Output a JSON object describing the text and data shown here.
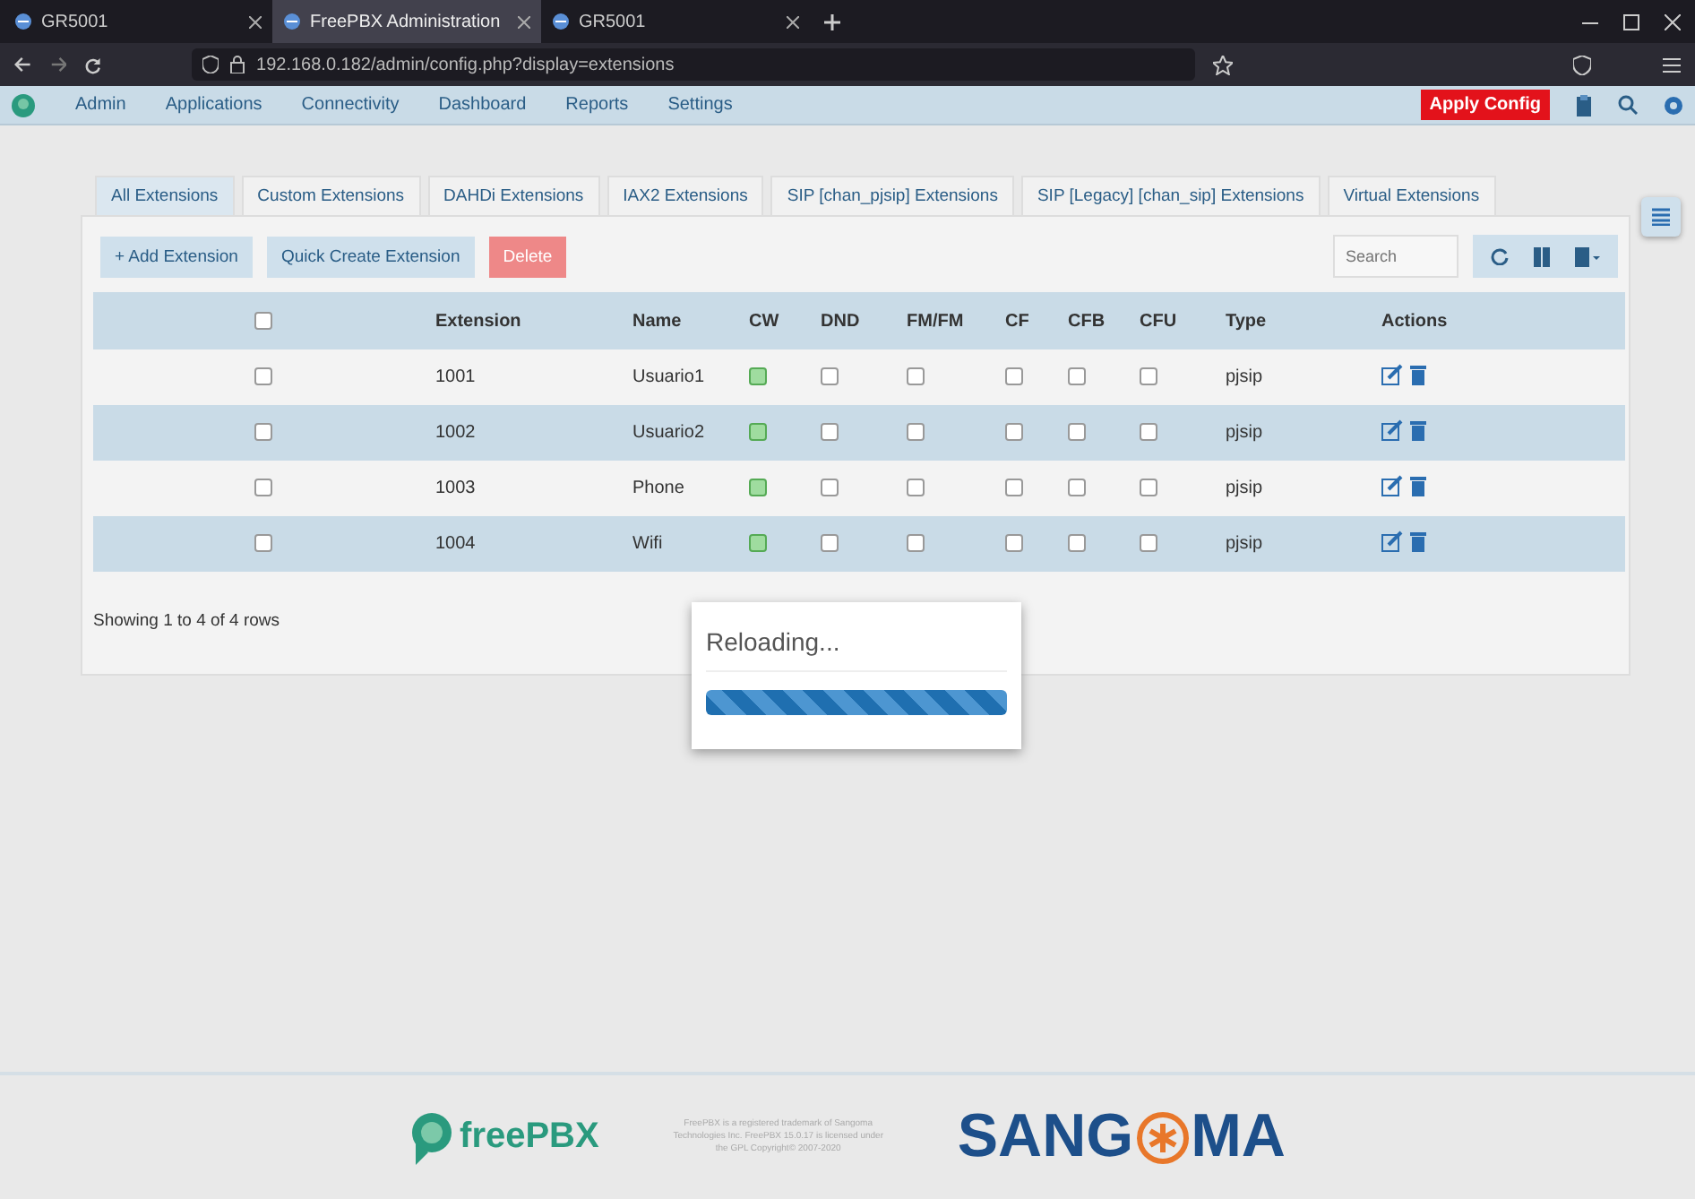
{
  "browser": {
    "tabs": [
      {
        "title": "GR5001",
        "selected": false
      },
      {
        "title": "FreePBX Administration",
        "selected": true
      },
      {
        "title": "GR5001",
        "selected": false
      }
    ],
    "address": "192.168.0.182/admin/config.php?display=extensions"
  },
  "nav": {
    "items": [
      "Admin",
      "Applications",
      "Connectivity",
      "Dashboard",
      "Reports",
      "Settings"
    ],
    "apply_button": "Apply Config"
  },
  "extension_tabs": [
    {
      "label": "All Extensions",
      "selected": true
    },
    {
      "label": "Custom Extensions",
      "selected": false
    },
    {
      "label": "DAHDi Extensions",
      "selected": false
    },
    {
      "label": "IAX2 Extensions",
      "selected": false
    },
    {
      "label": "SIP [chan_pjsip] Extensions",
      "selected": false
    },
    {
      "label": "SIP [Legacy] [chan_sip] Extensions",
      "selected": false
    },
    {
      "label": "Virtual Extensions",
      "selected": false
    }
  ],
  "toolbar": {
    "add_button": "+ Add Extension",
    "quick_create_button": "Quick Create Extension",
    "delete_button": "Delete",
    "search": {
      "placeholder": "Search"
    }
  },
  "table": {
    "columns": [
      {
        "kind": "select",
        "checked": false
      },
      {
        "label": "Extension",
        "kind": "text"
      },
      {
        "label": "Name",
        "kind": "text"
      },
      {
        "label": "CW",
        "kind": "flag"
      },
      {
        "label": "DND",
        "kind": "flag"
      },
      {
        "label": "FM/FM",
        "kind": "flag"
      },
      {
        "label": "CF",
        "kind": "flag"
      },
      {
        "label": "CFB",
        "kind": "flag"
      },
      {
        "label": "CFU",
        "kind": "flag"
      },
      {
        "label": "Type",
        "kind": "text"
      },
      {
        "label": "Actions",
        "kind": "actions"
      }
    ],
    "rows": [
      {
        "cells": [
          {
            "checked": false
          },
          {
            "text": "1001"
          },
          {
            "text": "Usuario1"
          },
          {
            "checked": true
          },
          {
            "checked": false
          },
          {
            "checked": false
          },
          {
            "checked": false
          },
          {
            "checked": false
          },
          {
            "checked": false
          },
          {
            "text": "pjsip"
          },
          {
            "kind": "actions"
          }
        ]
      },
      {
        "cells": [
          {
            "checked": false
          },
          {
            "text": "1002"
          },
          {
            "text": "Usuario2"
          },
          {
            "checked": true
          },
          {
            "checked": false
          },
          {
            "checked": false
          },
          {
            "checked": false
          },
          {
            "checked": false
          },
          {
            "checked": false
          },
          {
            "text": "pjsip"
          },
          {
            "kind": "actions"
          }
        ]
      },
      {
        "cells": [
          {
            "checked": false
          },
          {
            "text": "1003"
          },
          {
            "text": "Phone"
          },
          {
            "checked": true
          },
          {
            "checked": false
          },
          {
            "checked": false
          },
          {
            "checked": false
          },
          {
            "checked": false
          },
          {
            "checked": false
          },
          {
            "text": "pjsip"
          },
          {
            "kind": "actions"
          }
        ]
      },
      {
        "cells": [
          {
            "checked": false
          },
          {
            "text": "1004"
          },
          {
            "text": "Wifi"
          },
          {
            "checked": true
          },
          {
            "checked": false
          },
          {
            "checked": false
          },
          {
            "checked": false
          },
          {
            "checked": false
          },
          {
            "checked": false
          },
          {
            "text": "pjsip"
          },
          {
            "kind": "actions"
          }
        ]
      }
    ],
    "status": "Showing 1 to 4 of 4 rows"
  },
  "modal": {
    "title": "Reloading...",
    "level": 1
  },
  "footer": {
    "freepbx_logo": "freePBX",
    "legal": "FreePBX is a registered trademark of Sangoma Technologies Inc. FreePBX 15.0.17 is licensed under the GPL Copyright© 2007-2020",
    "sangoma_logo": [
      "SANG",
      "MA"
    ]
  }
}
